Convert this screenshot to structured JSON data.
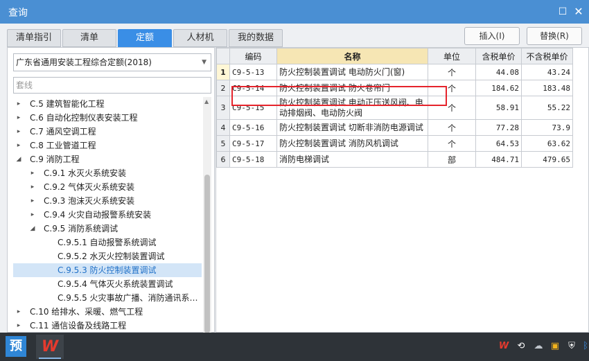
{
  "window": {
    "title": "查询",
    "maximize_icon": "maximize-icon",
    "close_icon": "close-icon"
  },
  "tabs": [
    {
      "label": "清单指引"
    },
    {
      "label": "清单"
    },
    {
      "label": "定额",
      "active": true
    },
    {
      "label": "人材机"
    },
    {
      "label": "我的数据"
    }
  ],
  "actions": {
    "insert": "插入(I)",
    "replace": "替换(R)"
  },
  "quota_library": {
    "selected": "广东省通用安装工程综合定额(2018)"
  },
  "search": {
    "placeholder": "套线"
  },
  "tree": [
    {
      "label": "C.5 建筑智能化工程",
      "toggle": "▸"
    },
    {
      "label": "C.6 自动化控制仪表安装工程",
      "toggle": "▸"
    },
    {
      "label": "C.7 通风空调工程",
      "toggle": "▸"
    },
    {
      "label": "C.8 工业管道工程",
      "toggle": "▸"
    },
    {
      "label": "C.9 消防工程",
      "toggle": "◢"
    },
    {
      "label": "C.9.1 水灭火系统安装",
      "toggle": "▸"
    },
    {
      "label": "C.9.2 气体灭火系统安装",
      "toggle": "▸"
    },
    {
      "label": "C.9.3 泡沫灭火系统安装",
      "toggle": "▸"
    },
    {
      "label": "C.9.4 火灾自动报警系统安装",
      "toggle": "▸"
    },
    {
      "label": "C.9.5 消防系统调试",
      "toggle": "◢"
    },
    {
      "label": "C.9.5.1 自动报警系统调试",
      "toggle": ""
    },
    {
      "label": "C.9.5.2 水灭火控制装置调试",
      "toggle": ""
    },
    {
      "label": "C.9.5.3 防火控制装置调试",
      "toggle": "",
      "selected": true
    },
    {
      "label": "C.9.5.4 气体灭火系统装置调试",
      "toggle": ""
    },
    {
      "label": "C.9.5.5 火灾事故广播、消防通讯系…",
      "toggle": ""
    },
    {
      "label": "C.10 给排水、采暖、燃气工程",
      "toggle": "▸"
    },
    {
      "label": "C.11 通信设备及线路工程",
      "toggle": "▸"
    }
  ],
  "table": {
    "headers": {
      "code": "编码",
      "name": "名称",
      "unit": "单位",
      "price_tax": "含税单价",
      "price_notax": "不含税单价"
    },
    "rows": [
      {
        "idx": "1",
        "code": "C9-5-13",
        "name": "防火控制装置调试 电动防火门(窗)",
        "unit": "个",
        "price_tax": "44.08",
        "price_notax": "43.24"
      },
      {
        "idx": "2",
        "code": "C9-5-14",
        "name": "防火控制装置调试 防火卷帘门",
        "unit": "个",
        "price_tax": "184.62",
        "price_notax": "183.48"
      },
      {
        "idx": "3",
        "code": "C9-5-15",
        "name": "防火控制装置调试 电动正压送风阀、电动排烟阀、电动防火阀",
        "unit": "个",
        "price_tax": "58.91",
        "price_notax": "55.22"
      },
      {
        "idx": "4",
        "code": "C9-5-16",
        "name": "防火控制装置调试 切断非消防电源调试",
        "unit": "个",
        "price_tax": "77.28",
        "price_notax": "73.9"
      },
      {
        "idx": "5",
        "code": "C9-5-17",
        "name": "防火控制装置调试 消防风机调试",
        "unit": "个",
        "price_tax": "64.53",
        "price_notax": "63.62"
      },
      {
        "idx": "6",
        "code": "C9-5-18",
        "name": "消防电梯调试",
        "unit": "部",
        "price_tax": "484.71",
        "price_notax": "479.65"
      }
    ]
  },
  "taskbar": {
    "app1_label": "预",
    "app2_label": "W",
    "tray_icons": [
      "wps-tray-icon",
      "network-icon",
      "cloud-icon",
      "folder-icon",
      "shield-icon",
      "bluetooth-icon"
    ]
  }
}
